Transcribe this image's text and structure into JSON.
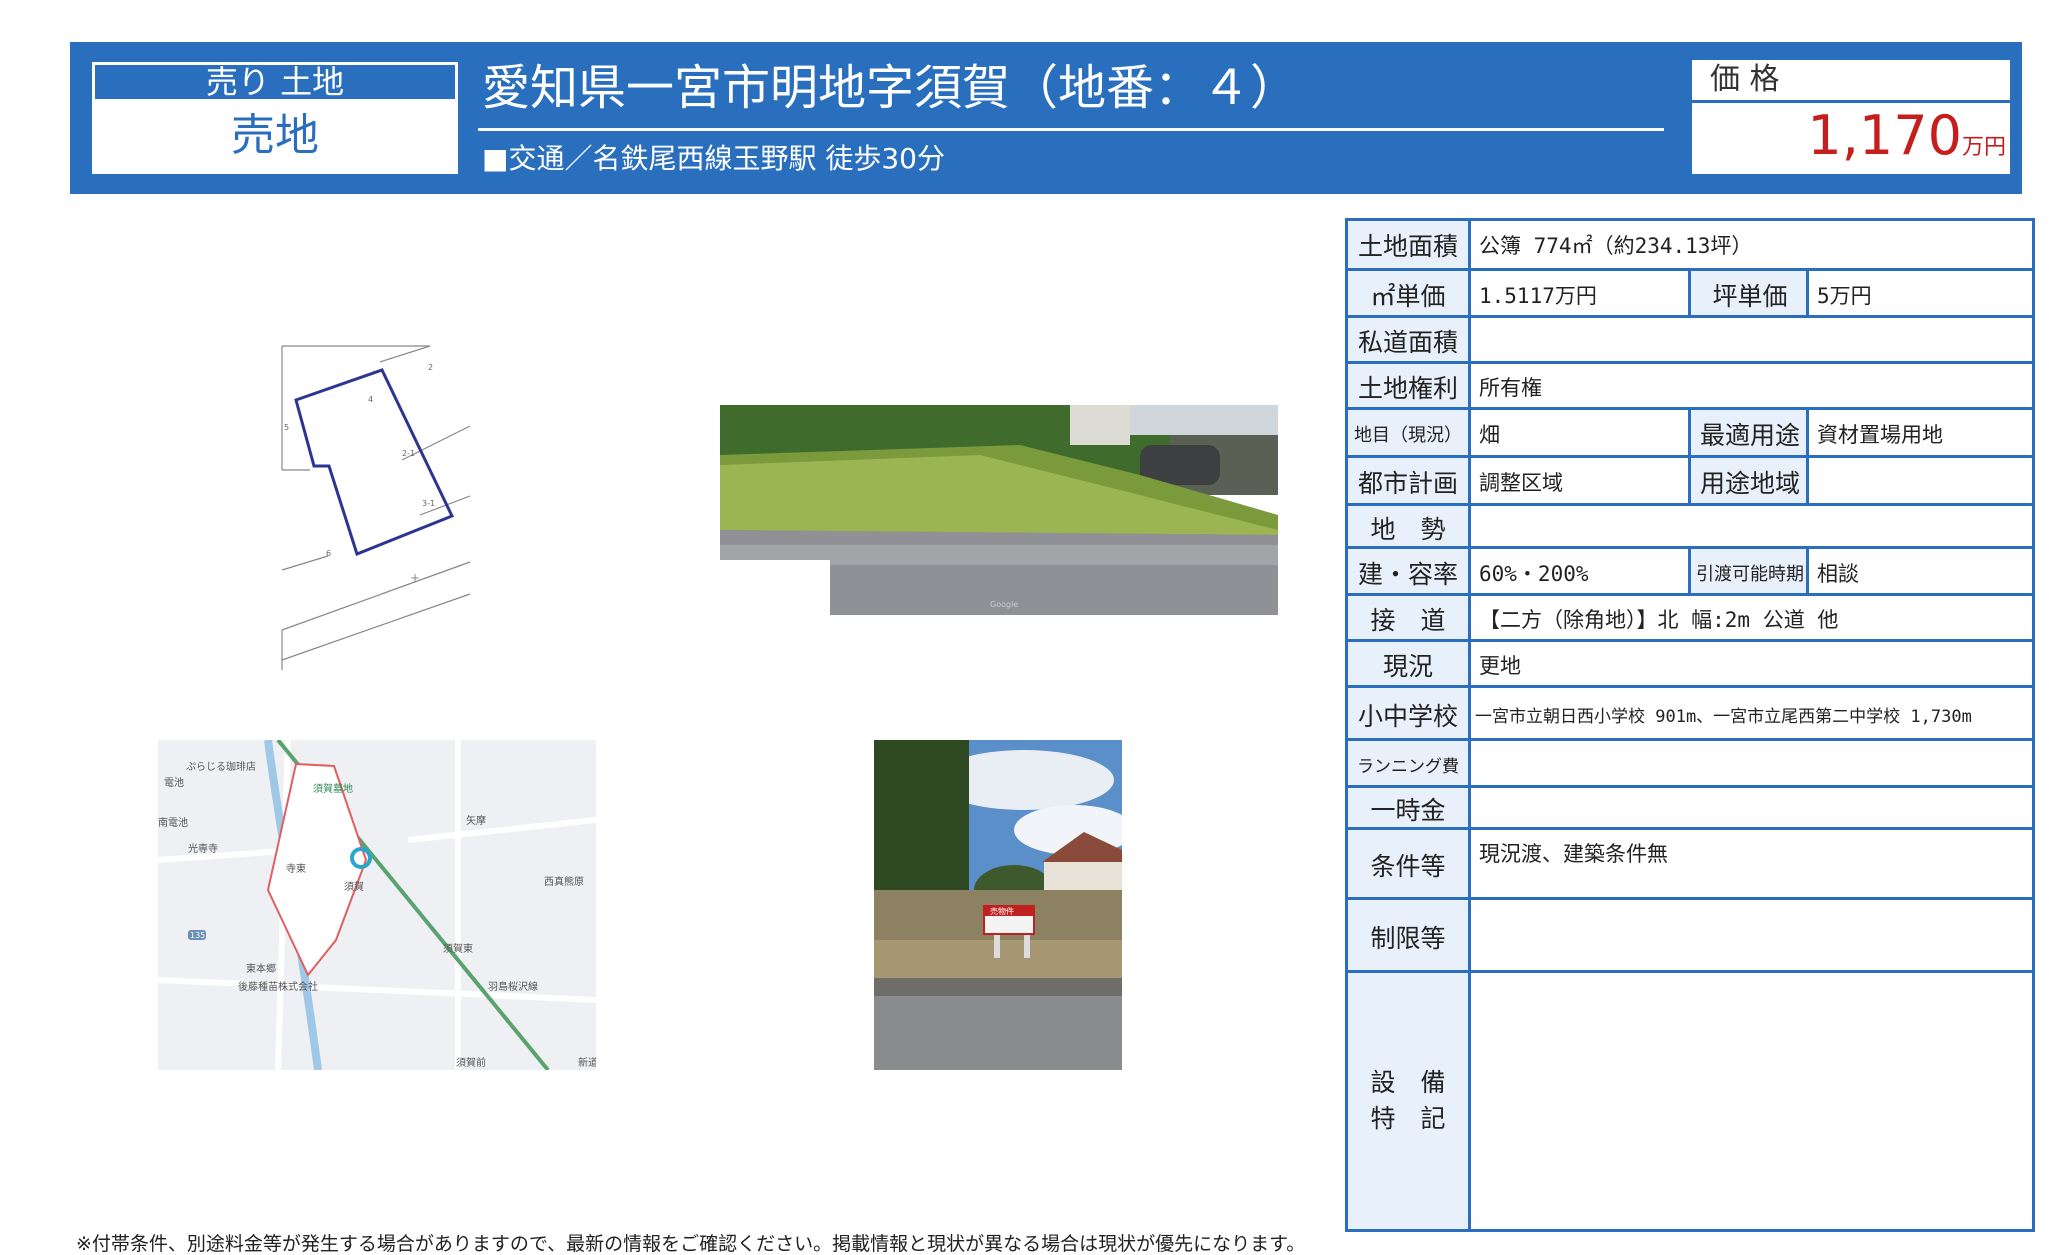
{
  "header": {
    "category_top": "売り 土地",
    "category_main": "売地",
    "title": "愛知県一宮市明地字須賀（地番：４）",
    "access": "■交通／名鉄尾西線玉野駅 徒歩30分",
    "price_label": "価 格",
    "price_value": "1,170",
    "price_unit": "万円"
  },
  "images": {
    "plot_labels": [
      "2",
      "4",
      "2-1",
      "3-1",
      "5",
      "6"
    ],
    "map_labels": {
      "cafe": "ぷらじる珈琲店",
      "cemetery": "須賀墓地",
      "kotei": "光専寺",
      "suga": "須賀",
      "suga_east": "須賀東",
      "higashi_hongo": "東本郷",
      "seed_company": "後藤種苗株式会社",
      "route": "135",
      "yanou": "矢摩",
      "nishimaki": "西真熊原",
      "temple_east": "寺東",
      "minami_denchi": "南電池",
      "denchi": "電池",
      "haneshima": "羽島桜沢線",
      "suga_mae": "須賀前",
      "shinden": "新道"
    },
    "sign_text": "売物件"
  },
  "details": {
    "land_area": {
      "label": "土地面積",
      "value": "公簿 774㎡（約234.13坪）"
    },
    "sqm_price": {
      "label": "㎡単価",
      "value": "1.5117万円"
    },
    "tsubo_price": {
      "label": "坪単価",
      "value": "5万円"
    },
    "private_road": {
      "label": "私道面積",
      "value": ""
    },
    "land_rights": {
      "label": "土地権利",
      "value": "所有権"
    },
    "land_category": {
      "label": "地目（現況）",
      "value": "畑"
    },
    "best_use": {
      "label": "最適用途",
      "value": "資材置場用地"
    },
    "city_plan": {
      "label": "都市計画",
      "value": "調整区域"
    },
    "zoning": {
      "label": "用途地域",
      "value": ""
    },
    "terrain": {
      "label": "地　勢",
      "value": ""
    },
    "coverage": {
      "label": "建・容率",
      "value": "60%・200%"
    },
    "handover": {
      "label": "引渡可能時期",
      "value": "相談"
    },
    "road": {
      "label": "接　道",
      "value": "【二方（除角地）】北 幅:2m 公道 他"
    },
    "status": {
      "label": "現況",
      "value": "更地"
    },
    "schools": {
      "label": "小中学校",
      "value": "一宮市立朝日西小学校 901m、一宮市立尾西第二中学校 1,730m"
    },
    "running_cost": {
      "label": "ランニング費",
      "value": ""
    },
    "lump_sum": {
      "label": "一時金",
      "value": ""
    },
    "conditions": {
      "label": "条件等",
      "value": "現況渡、建築条件無"
    },
    "restrictions": {
      "label": "制限等",
      "value": ""
    },
    "facilities_label_1": "設　備",
    "facilities_label_2": "特　記",
    "facilities_value": ""
  },
  "footnote": "※付帯条件、別途料金等が発生する場合がありますので、最新の情報をご確認ください。掲載情報と現状が異なる場合は現状が優先になります。",
  "colors": {
    "accent": "#2a6fbe",
    "price": "#c61d1d",
    "label_bg": "#e8f0fb"
  }
}
